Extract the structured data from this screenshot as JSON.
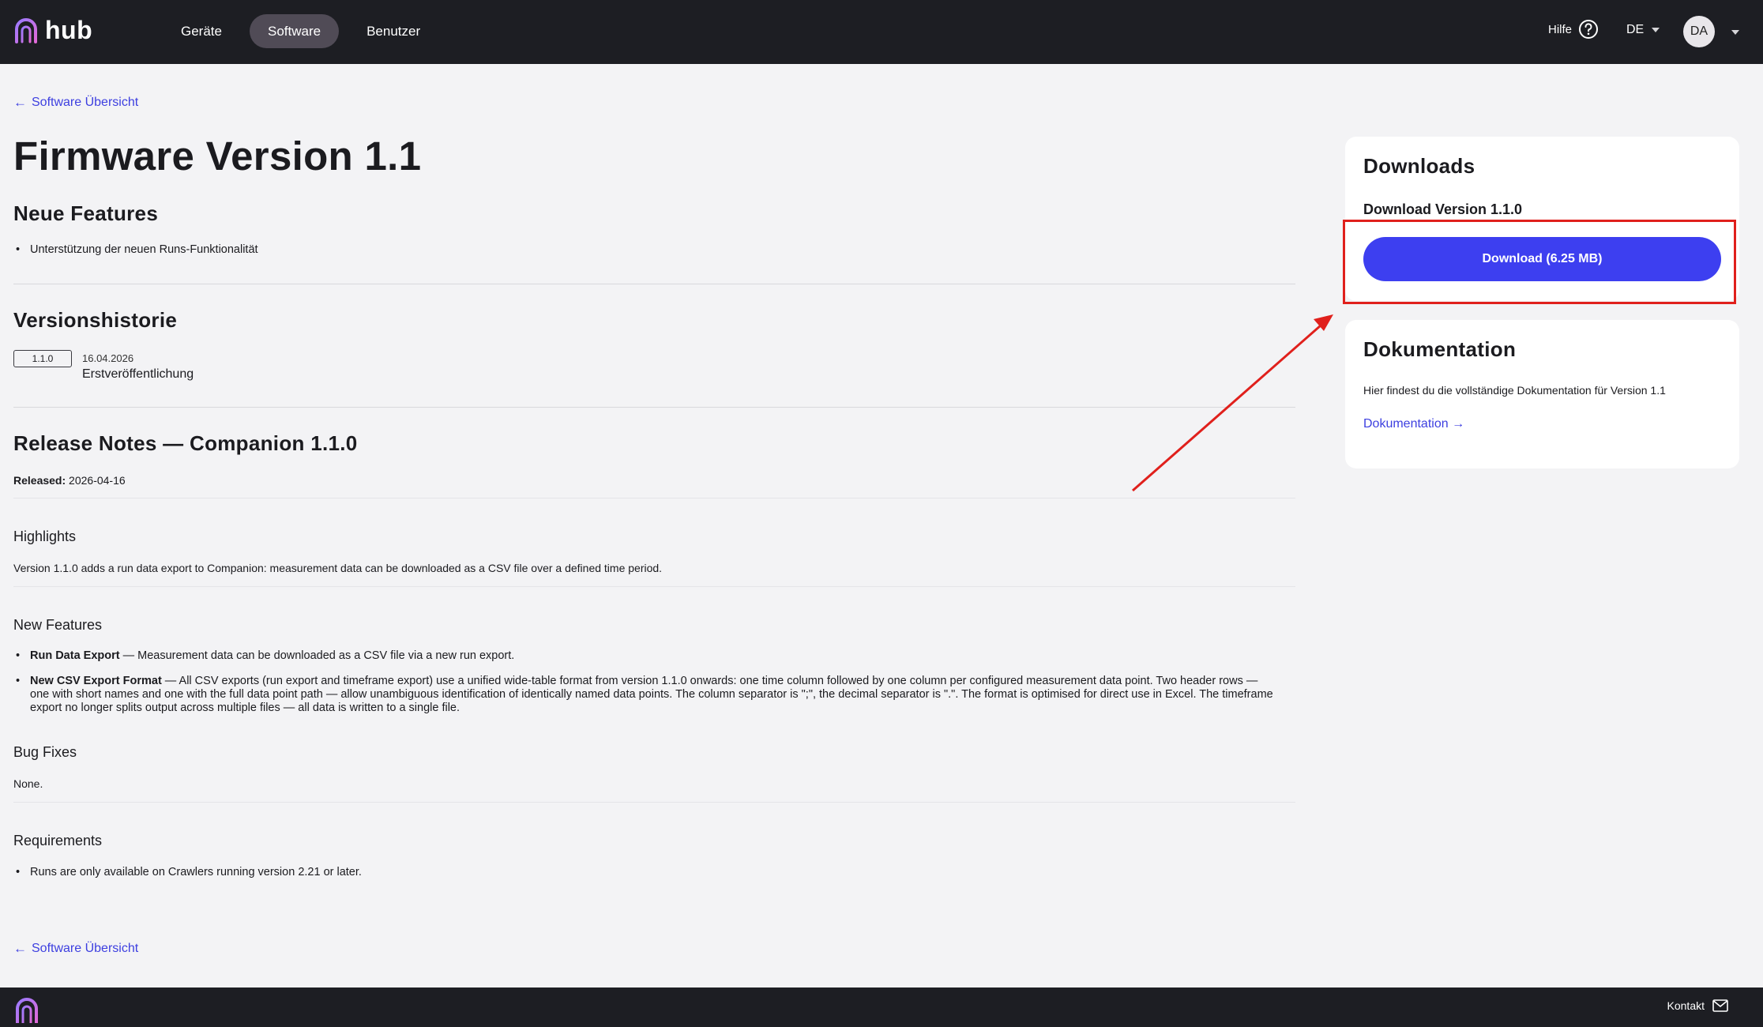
{
  "header": {
    "logo_text": "hub",
    "nav": [
      {
        "label": "Geräte",
        "active": false
      },
      {
        "label": "Software",
        "active": true
      },
      {
        "label": "Benutzer",
        "active": false
      }
    ],
    "help_label": "Hilfe",
    "language": "DE",
    "user_initials": "DA"
  },
  "main": {
    "back_link": "Software Übersicht",
    "title": "Firmware Version 1.1",
    "features": {
      "heading": "Neue Features",
      "items": [
        "Unterstützung der neuen Runs-Funktionalität"
      ]
    },
    "history": {
      "heading": "Versionshistorie",
      "entries": [
        {
          "version": "1.1.0",
          "date": "16.04.2026",
          "description": "Erstveröffentlichung"
        }
      ]
    },
    "release_notes": {
      "heading": "Release Notes — Companion 1.1.0",
      "released_label": "Released:",
      "released_date": "2026-04-16",
      "highlights_heading": "Highlights",
      "highlights_text": "Version 1.1.0 adds a run data export to Companion: measurement data can be downloaded as a CSV file over a defined time period.",
      "new_features_heading": "New Features",
      "new_features": [
        {
          "title": "Run Data Export",
          "text": " — Measurement data can be downloaded as a CSV file via a new run export."
        },
        {
          "title": "New CSV Export Format",
          "text": " — All CSV exports (run export and timeframe export) use a unified wide-table format from version 1.1.0 onwards: one time column followed by one column per configured measurement data point. Two header rows — one with short names and one with the full data point path — allow unambiguous identification of identically named data points. The column separator is \";\", the decimal separator is \".\". The format is optimised for direct use in Excel. The timeframe export no longer splits output across multiple files — all data is written to a single file."
        }
      ],
      "bug_fixes_heading": "Bug Fixes",
      "bug_fixes_text": "None.",
      "requirements_heading": "Requirements",
      "requirements": [
        "Runs are only available on Crawlers running version 2.21 or later."
      ]
    },
    "bottom_back_link": "Software Übersicht"
  },
  "sidebar": {
    "downloads": {
      "heading": "Downloads",
      "label": "Download Version 1.1.0",
      "button": "Download (6.25 MB)"
    },
    "docs": {
      "heading": "Dokumentation",
      "text": "Hier findest du die vollständige Dokumentation für Version 1.1",
      "link": "Dokumentation"
    }
  },
  "footer": {
    "contact": "Kontakt"
  },
  "colors": {
    "accent": "#3d3ff0",
    "link": "#3d3fe0",
    "topbar": "#1d1e23",
    "annotation": "#e0201c"
  }
}
